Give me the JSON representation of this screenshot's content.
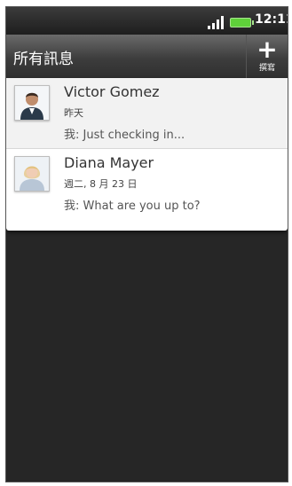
{
  "status_bar": {
    "time": "12:11",
    "battery_color": "#5fd03a"
  },
  "header": {
    "title": "所有訊息",
    "compose_label": "撰寫"
  },
  "messages": [
    {
      "name": "Victor Gomez",
      "date": "昨天",
      "preview": "我: Just checking in...",
      "avatar_icon": "contact-photo-man"
    },
    {
      "name": "Diana Mayer",
      "date": "週二, 8 月 23 日",
      "preview": "我: What are you up to?",
      "avatar_icon": "contact-photo-woman"
    }
  ]
}
